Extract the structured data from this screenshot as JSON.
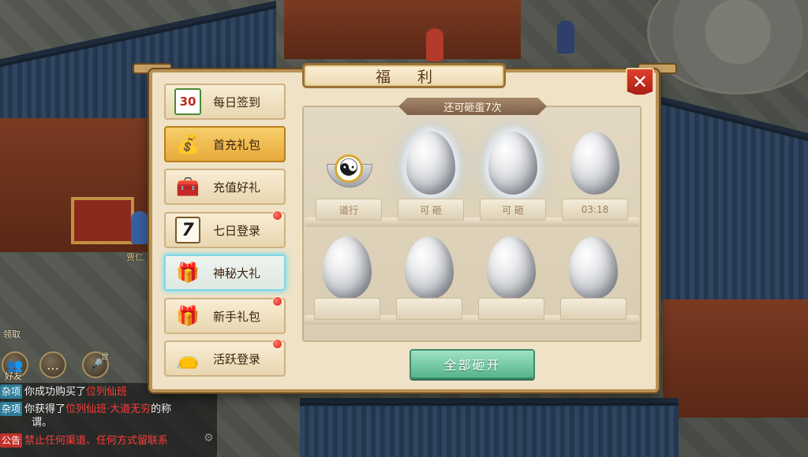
{
  "panel": {
    "title": "福 利",
    "close_icon": "close-icon"
  },
  "menu": [
    {
      "label": "每日签到",
      "icon": "calendar-30-icon",
      "glyph": "30",
      "active": false,
      "dot": false
    },
    {
      "label": "首充礼包",
      "icon": "gold-coin-bag-icon",
      "glyph": "💰",
      "active": true,
      "dot": false
    },
    {
      "label": "充值好礼",
      "icon": "treasure-chest-icon",
      "glyph": "🧰",
      "active": false,
      "dot": false
    },
    {
      "label": "七日登录",
      "icon": "calendar-7-icon",
      "glyph": "7",
      "active": false,
      "dot": true
    },
    {
      "label": "神秘大礼",
      "icon": "mystery-chest-icon",
      "glyph": "🎁",
      "active": false,
      "hover": true,
      "dot": false
    },
    {
      "label": "新手礼包",
      "icon": "gift-box-icon",
      "glyph": "🎁",
      "active": false,
      "dot": true
    },
    {
      "label": "活跃登录",
      "icon": "red-pouch-icon",
      "glyph": "👝",
      "active": false,
      "dot": true
    }
  ],
  "eggs": {
    "remaining_text": "还可砸蛋7次",
    "row1": [
      {
        "label": "道行",
        "state": "opened"
      },
      {
        "label": "可 砸",
        "state": "ready"
      },
      {
        "label": "可 砸",
        "state": "ready"
      },
      {
        "label": "03:18",
        "state": "timer"
      }
    ],
    "row2": [
      {
        "label": "",
        "state": "locked"
      },
      {
        "label": "",
        "state": "locked"
      },
      {
        "label": "",
        "state": "locked"
      },
      {
        "label": "",
        "state": "locked"
      }
    ],
    "smash_all_label": "全部砸开"
  },
  "hud": {
    "friends_label": "好友",
    "left_label": "领取",
    "npc_name_fragment": "贾仁",
    "voice_label": "世"
  },
  "chat": [
    {
      "tag": "杂项",
      "tag_type": "misc",
      "text": "你成功购买了",
      "highlight": "位列仙班"
    },
    {
      "tag": "杂项",
      "tag_type": "misc",
      "text": "你获得了",
      "highlight": "位列仙班·大道无穷",
      "tail": "的称"
    },
    {
      "tag": "",
      "tag_type": "",
      "text": "谓。",
      "highlight": ""
    },
    {
      "tag": "公告",
      "tag_type": "notice",
      "text": "",
      "highlight": "禁止任何渠道、任何方式留联系"
    }
  ],
  "colors": {
    "accent_gold": "#e8a93a",
    "close_red": "#c0281d",
    "smash_green": "#55b48c",
    "notification_red": "#d81f12"
  }
}
